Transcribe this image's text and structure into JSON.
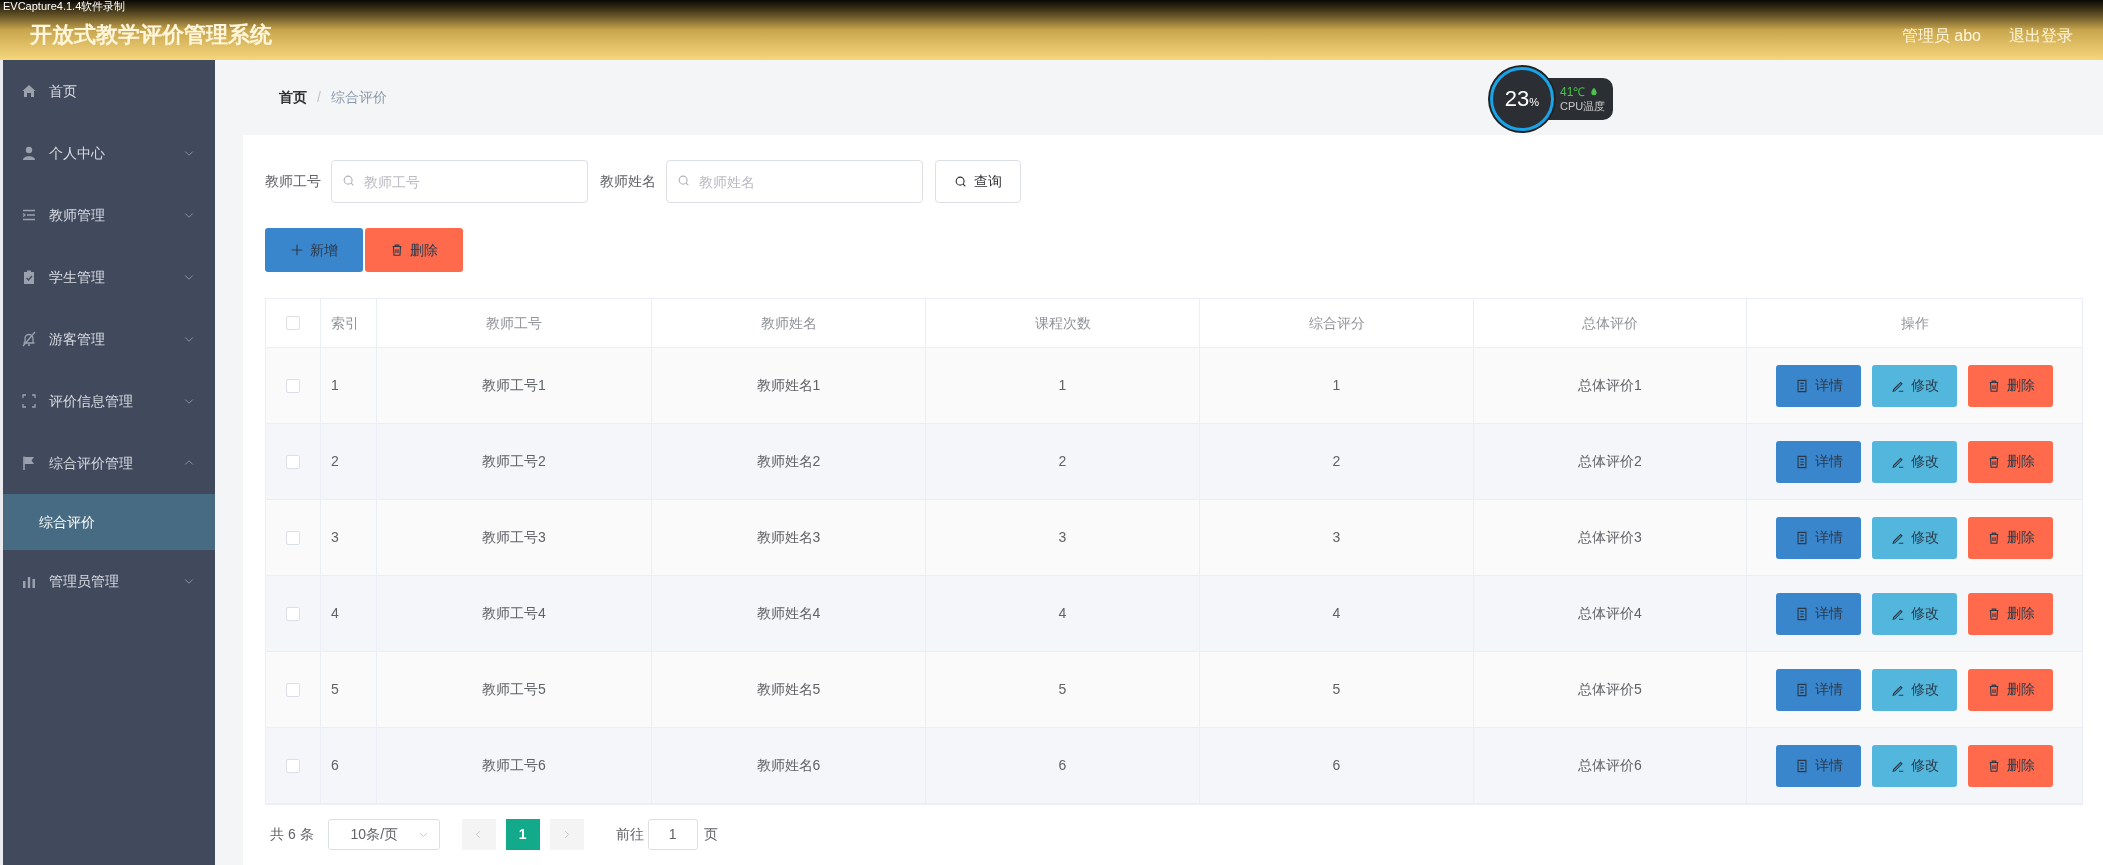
{
  "recorder_label": "EVCapture4.1.4软件录制",
  "header": {
    "title": "开放式教学评价管理系统",
    "user": "管理员 abo",
    "logout": "退出登录"
  },
  "sidebar": {
    "items": [
      {
        "label": "首页",
        "kind": "link"
      },
      {
        "label": "个人中心",
        "kind": "menu",
        "expanded": false
      },
      {
        "label": "教师管理",
        "kind": "menu",
        "expanded": false
      },
      {
        "label": "学生管理",
        "kind": "menu",
        "expanded": false
      },
      {
        "label": "游客管理",
        "kind": "menu",
        "expanded": false
      },
      {
        "label": "评价信息管理",
        "kind": "menu",
        "expanded": false
      },
      {
        "label": "综合评价管理",
        "kind": "menu",
        "expanded": true,
        "children": [
          {
            "label": "综合评价",
            "selected": true
          }
        ]
      },
      {
        "label": "管理员管理",
        "kind": "menu",
        "expanded": false
      }
    ]
  },
  "breadcrumb": [
    "首页",
    "综合评价"
  ],
  "breadcrumb_separator": "/",
  "cpu_widget": {
    "percent": "23",
    "unit": "%",
    "temperature": "41℃",
    "label": "CPU温度"
  },
  "search": {
    "fields": [
      {
        "label": "教师工号",
        "placeholder": "教师工号"
      },
      {
        "label": "教师姓名",
        "placeholder": "教师姓名"
      }
    ],
    "button": "查询"
  },
  "actions": [
    {
      "label": "新增",
      "kind": "add"
    },
    {
      "label": "删除",
      "kind": "delete"
    }
  ],
  "table": {
    "header_checked": false,
    "columns": [
      "索引",
      "教师工号",
      "教师姓名",
      "课程次数",
      "综合评分",
      "总体评价",
      "操作"
    ],
    "rows": [
      {
        "checked": false,
        "cells": [
          "1",
          "教师工号1",
          "教师姓名1",
          "1",
          "1",
          "总体评价1"
        ],
        "actions": [
          {
            "label": "详情",
            "kind": "detail"
          },
          {
            "label": "修改",
            "kind": "edit"
          },
          {
            "label": "删除",
            "kind": "delete"
          }
        ]
      },
      {
        "checked": false,
        "cells": [
          "2",
          "教师工号2",
          "教师姓名2",
          "2",
          "2",
          "总体评价2"
        ],
        "actions": [
          {
            "label": "详情",
            "kind": "detail"
          },
          {
            "label": "修改",
            "kind": "edit"
          },
          {
            "label": "删除",
            "kind": "delete"
          }
        ]
      },
      {
        "checked": false,
        "cells": [
          "3",
          "教师工号3",
          "教师姓名3",
          "3",
          "3",
          "总体评价3"
        ],
        "actions": [
          {
            "label": "详情",
            "kind": "detail"
          },
          {
            "label": "修改",
            "kind": "edit"
          },
          {
            "label": "删除",
            "kind": "delete"
          }
        ]
      },
      {
        "checked": false,
        "cells": [
          "4",
          "教师工号4",
          "教师姓名4",
          "4",
          "4",
          "总体评价4"
        ],
        "actions": [
          {
            "label": "详情",
            "kind": "detail"
          },
          {
            "label": "修改",
            "kind": "edit"
          },
          {
            "label": "删除",
            "kind": "delete"
          }
        ]
      },
      {
        "checked": false,
        "cells": [
          "5",
          "教师工号5",
          "教师姓名5",
          "5",
          "5",
          "总体评价5"
        ],
        "actions": [
          {
            "label": "详情",
            "kind": "detail"
          },
          {
            "label": "修改",
            "kind": "edit"
          },
          {
            "label": "删除",
            "kind": "delete"
          }
        ]
      },
      {
        "checked": false,
        "cells": [
          "6",
          "教师工号6",
          "教师姓名6",
          "6",
          "6",
          "总体评价6"
        ],
        "actions": [
          {
            "label": "详情",
            "kind": "detail"
          },
          {
            "label": "修改",
            "kind": "edit"
          },
          {
            "label": "删除",
            "kind": "delete"
          }
        ]
      }
    ]
  },
  "pagination": {
    "total": "共 6 条",
    "page_size": "10条/页",
    "pages": [
      {
        "label": "1",
        "selected": true
      }
    ],
    "goto_label": "前往",
    "goto_value": "1",
    "page_suffix": "页"
  }
}
